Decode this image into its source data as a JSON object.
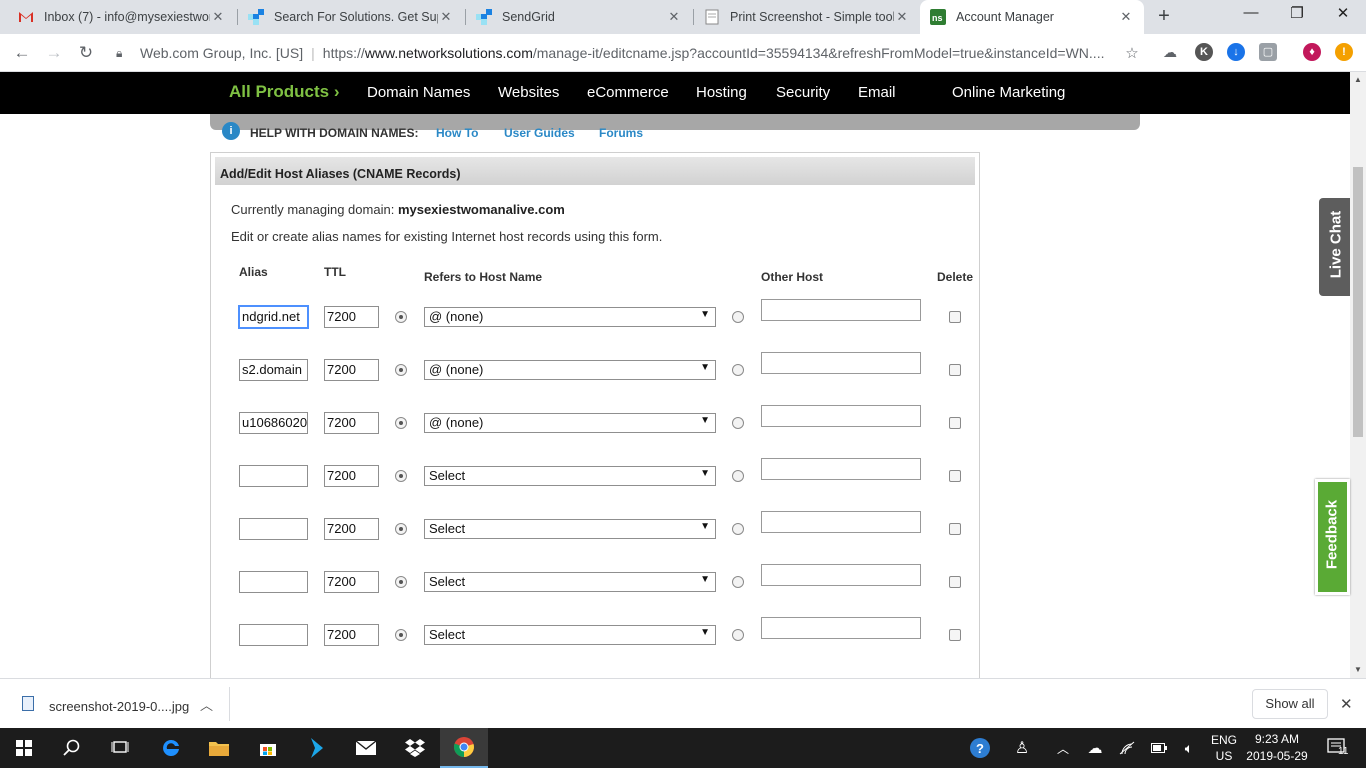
{
  "browser": {
    "tabs": [
      {
        "title": "Inbox (7) - info@mysexiestwon",
        "icon": "gmail-icon",
        "active": false
      },
      {
        "title": "Search For Solutions. Get Supp",
        "icon": "sendgrid-icon",
        "active": false
      },
      {
        "title": "SendGrid",
        "icon": "sendgrid-icon",
        "active": false
      },
      {
        "title": "Print Screenshot - Simple tool",
        "icon": "page-icon",
        "active": false
      },
      {
        "title": "Account Manager",
        "icon": "networksolutions-icon",
        "active": true
      }
    ],
    "new_tab_symbol": "+",
    "window_controls": {
      "minimize": "—",
      "restore": "❐",
      "close": "✕"
    },
    "address": {
      "org": "Web.com Group, Inc. [US]",
      "url_prefix": "https://",
      "url_host": "www.networksolutions.com",
      "url_path": "/manage-it/editcname.jsp?accountId=35594134&refreshFromModel=true&instanceId=WN...."
    },
    "extensions": [
      {
        "label": "K",
        "color": "#555555"
      },
      {
        "label": "↓",
        "color": "#1a73e8"
      },
      {
        "label": "▢",
        "color": "#9aa0a6"
      },
      {
        "label": "♦",
        "color": "#c2185b"
      },
      {
        "label": "!",
        "color": "#f4a000"
      }
    ]
  },
  "site_nav": {
    "all_products": "All Products ›",
    "items": [
      "Domain Names",
      "Websites",
      "eCommerce",
      "Hosting",
      "Security",
      "Email",
      "Online Marketing"
    ]
  },
  "help_bar": {
    "label": "HELP WITH DOMAIN NAMES:",
    "links": [
      "How To",
      "User Guides",
      "Forums"
    ]
  },
  "panel": {
    "title": "Add/Edit Host Aliases (CNAME Records)",
    "managing_label": "Currently managing domain:",
    "managing_domain": "mysexiestwomanalive.com",
    "description": "Edit or create alias names for existing Internet host records using this form.",
    "columns": {
      "alias": "Alias",
      "ttl": "TTL",
      "refers": "Refers to Host Name",
      "other": "Other Host",
      "delete": "Delete"
    },
    "rows": [
      {
        "alias": "ndgrid.net",
        "ttl": "7200",
        "refers": "@ (none)",
        "other": "",
        "focused": true
      },
      {
        "alias": "s2.domain",
        "ttl": "7200",
        "refers": "@ (none)",
        "other": "",
        "focused": false
      },
      {
        "alias": "u10686020",
        "ttl": "7200",
        "refers": "@ (none)",
        "other": "",
        "focused": false
      },
      {
        "alias": "",
        "ttl": "7200",
        "refers": "Select",
        "other": "",
        "focused": false
      },
      {
        "alias": "",
        "ttl": "7200",
        "refers": "Select",
        "other": "",
        "focused": false
      },
      {
        "alias": "",
        "ttl": "7200",
        "refers": "Select",
        "other": "",
        "focused": false
      },
      {
        "alias": "",
        "ttl": "7200",
        "refers": "Select",
        "other": "",
        "focused": false
      }
    ]
  },
  "side_tabs": {
    "live_chat": "Live Chat",
    "feedback": "Feedback"
  },
  "download_bar": {
    "file_name": "screenshot-2019-0....jpg",
    "show_all": "Show all",
    "close_symbol": "✕"
  },
  "taskbar": {
    "language": "ENG",
    "region": "US",
    "time": "9:23 AM",
    "date": "2019-05-29",
    "notification_count": "11"
  }
}
